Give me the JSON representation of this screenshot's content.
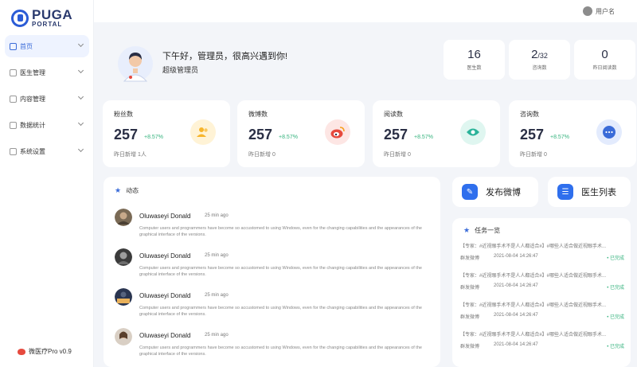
{
  "app": {
    "logo_title": "PUGA",
    "logo_sub": "PORTAL",
    "version": "微医疗Pro v0.9"
  },
  "sidebar": {
    "items": [
      {
        "label": "首页",
        "active": true
      },
      {
        "label": "医生管理"
      },
      {
        "label": "内容管理"
      },
      {
        "label": "数据统计"
      },
      {
        "label": "系统设置"
      }
    ]
  },
  "topbar": {
    "username": "用户名"
  },
  "greeting": {
    "title": "下午好，管理员，很高兴遇到你!",
    "role": "超级管理员"
  },
  "stats": [
    {
      "value": "16",
      "suffix": "",
      "label": "医生数"
    },
    {
      "value": "2",
      "suffix": "/32",
      "label": "咨询数"
    },
    {
      "value": "0",
      "suffix": "",
      "label": "昨日阅读数"
    }
  ],
  "cards": [
    {
      "title": "粉丝数",
      "value": "257",
      "delta": "+8.57%",
      "foot": "昨日新增 1人",
      "icon": "users-icon",
      "color": "#f7b52c",
      "bg": "#fff3d6"
    },
    {
      "title": "微博数",
      "value": "257",
      "delta": "+8.57%",
      "foot": "昨日新增 0",
      "icon": "weibo-icon",
      "color": "#e64a3e",
      "bg": "#fde6e4"
    },
    {
      "title": "阅读数",
      "value": "257",
      "delta": "+8.57%",
      "foot": "昨日新增 0",
      "icon": "eye-icon",
      "color": "#2bb39a",
      "bg": "#dff6f0"
    },
    {
      "title": "咨询数",
      "value": "257",
      "delta": "+8.57%",
      "foot": "昨日新增 0",
      "icon": "chat-icon",
      "color": "#3a6bd8",
      "bg": "#e3ebfd"
    }
  ],
  "feed": {
    "title": "动态",
    "items": [
      {
        "name": "Oluwaseyi Donald",
        "time": "25 min ago",
        "text": "Computer users and programmers have become so accustomed to using Windows, even for the changing capabilities and the appearances of the graphical interface of the versions."
      },
      {
        "name": "Oluwaseyi Donald",
        "time": "25 min ago",
        "text": "Computer users and programmers have become so accustomed to using Windows, even for the changing capabilities and the appearances of the graphical interface of the versions."
      },
      {
        "name": "Oluwaseyi Donald",
        "time": "25 min ago",
        "text": "Computer users and programmers have become so accustomed to using Windows, even for the changing capabilities and the appearances of the graphical interface of the versions."
      },
      {
        "name": "Oluwaseyi Donald",
        "time": "25 min ago",
        "text": "Computer users and programmers have become so accustomed to using Windows, even for the changing capabilities and the appearances of the graphical interface of the versions."
      }
    ]
  },
  "actions": {
    "publish": "发布微博",
    "doctors": "医生列表"
  },
  "tasks": {
    "title": "任务一览",
    "items": [
      {
        "title": "【专家：#近视眼手术不是人人都适合#】#哪些人适合做近视眼手术...",
        "source": "群发微博",
        "date": "2021-08-04  14:26:47",
        "status": "• 已完成"
      },
      {
        "title": "【专家：#近视眼手术不是人人都适合#】#哪些人适合做近视眼手术...",
        "source": "群发微博",
        "date": "2021-08-04  14:26:47",
        "status": "• 已完成"
      },
      {
        "title": "【专家：#近视眼手术不是人人都适合#】#哪些人适合做近视眼手术...",
        "source": "群发微博",
        "date": "2021-08-04  14:26:47",
        "status": "• 已完成"
      },
      {
        "title": "【专家：#近视眼手术不是人人都适合#】#哪些人适合做近视眼手术...",
        "source": "群发微博",
        "date": "2021-08-04  14:26:47",
        "status": "• 已完成"
      }
    ]
  }
}
